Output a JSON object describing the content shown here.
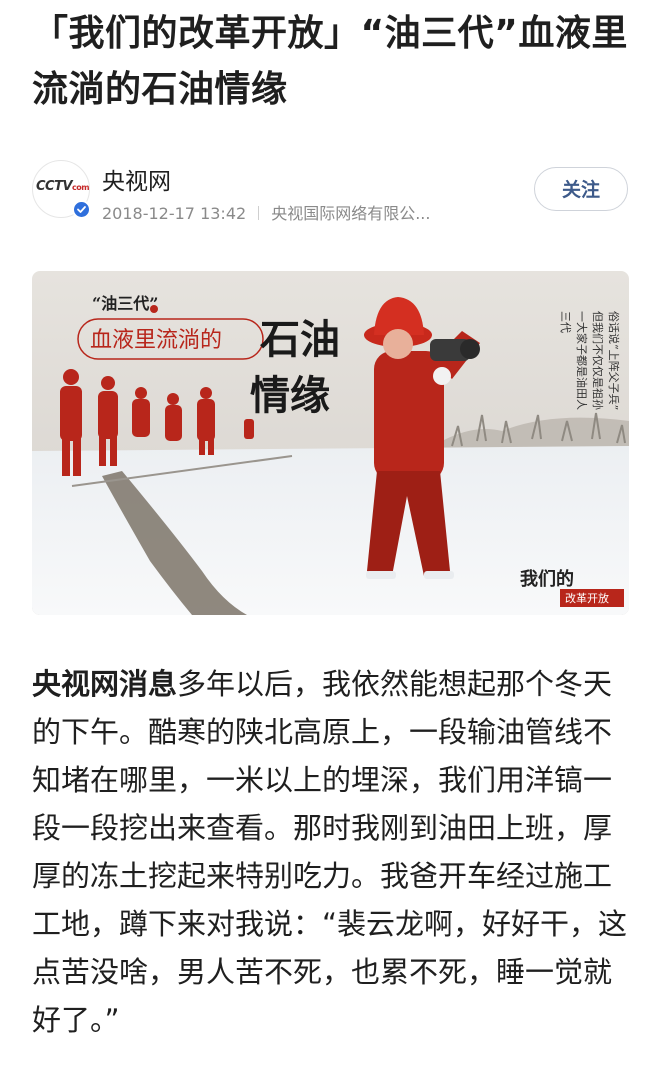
{
  "article": {
    "title": "「我们的改革开放」“油三代”血液里流淌的石油情缘",
    "author": {
      "name": "央视网",
      "avatar_logo": "CCTV",
      "avatar_logo_suffix": "com",
      "verified_icon": "verified-badge-icon",
      "date": "2018-12-17 13:42",
      "organization": "央视国际网络有限公..."
    },
    "follow_label": "关注",
    "hero": {
      "badge": "“油三代”",
      "subtitle": "血液里流淌的",
      "title_line1": "石油",
      "title_line2": "情缘",
      "poem": [
        "俗话说“上阵父子兵”",
        "但我们不仅仅是祖孙",
        "一大家子都是油田人",
        "三代"
      ],
      "series_logo": "我们的",
      "series_tag": "改革开放"
    },
    "body": {
      "lead": "央视网消息",
      "text": "多年以后，我依然能想起那个冬天的下午。酷寒的陕北高原上，一段输油管线不知堵在哪里，一米以上的埋深，我们用洋镐一段一段挖出来查看。那时我刚到油田上班，厚厚的冻土挖起来特别吃力。我爸开车经过施工工地，蹲下来对我说：“裴云龙啊，好好干，这点苦没啥，男人苦不死，也累不死，睡一觉就好了。”"
    },
    "colors": {
      "worker_red": "#b8261b",
      "follow_text": "#3d5a8a",
      "verified_blue": "#2f6fdc"
    }
  }
}
